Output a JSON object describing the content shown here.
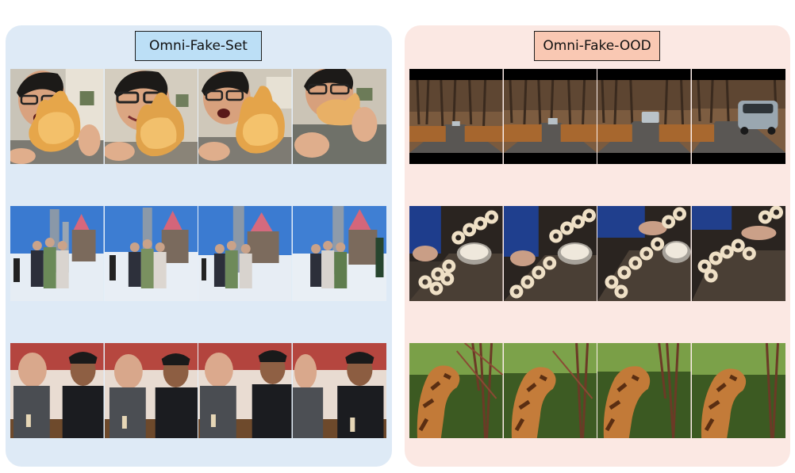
{
  "figure": {
    "left_panel": {
      "title": "Omni-Fake-Set",
      "background": "#deeaf6",
      "title_fill": "#bcdff6",
      "rows": [
        {
          "scene": "man-with-glasses-eating-bread",
          "frames": 4
        },
        {
          "scene": "group-photo-in-snowy-village",
          "frames": 4
        },
        {
          "scene": "two-men-tasting-at-brewery",
          "frames": 4
        }
      ]
    },
    "right_panel": {
      "title": "Omni-Fake-OOD",
      "background": "#fbe8e3",
      "title_fill": "#f9c8b3",
      "rows": [
        {
          "scene": "car-on-autumn-forest-road",
          "frames": 4
        },
        {
          "scene": "bagel-dough-production-line",
          "frames": 4
        },
        {
          "scene": "giraffe-eating-branches",
          "frames": 4
        }
      ]
    }
  }
}
